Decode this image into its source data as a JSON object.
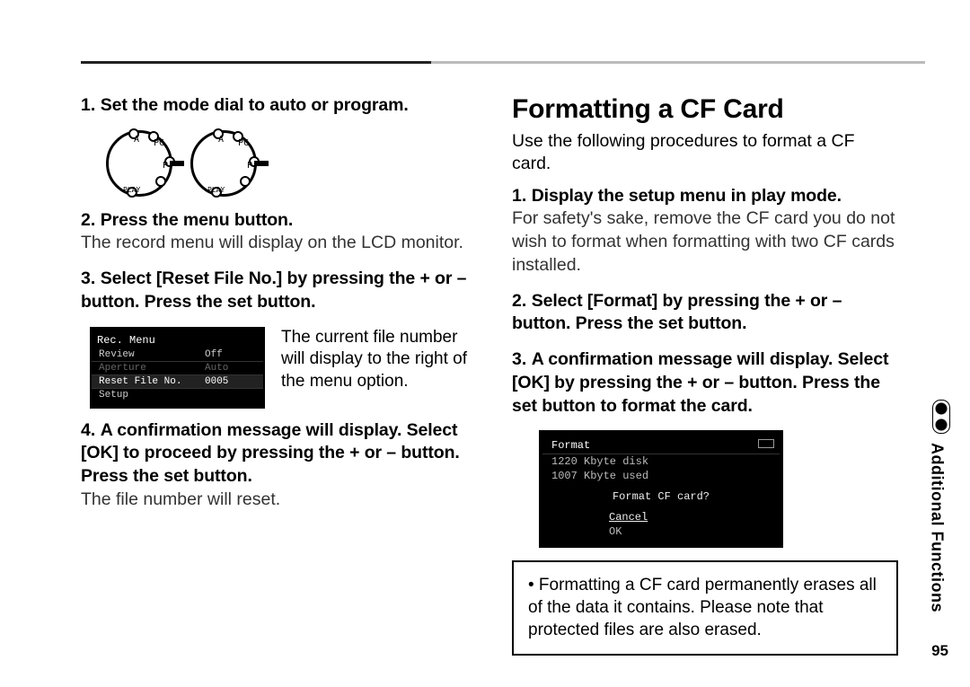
{
  "left": {
    "step1": {
      "num": "1.",
      "text": "Set the mode dial to auto or program."
    },
    "step2": {
      "num": "2.",
      "bold": "Press the menu button.",
      "desc": "The record menu will display on the LCD monitor."
    },
    "step3": {
      "num": "3.",
      "text": "Select [Reset File No.] by pressing the + or – button. Press the set button."
    },
    "lcd": {
      "title": "Rec. Menu",
      "rows": [
        {
          "label": "Review",
          "value": "Off"
        },
        {
          "label": "Aperture",
          "value": "Auto",
          "dim": true
        },
        {
          "label": "Reset File No.",
          "value": "0005",
          "hl": true
        },
        {
          "label": "Setup",
          "value": ""
        }
      ],
      "caption": "The current file number will display to the right of the menu option."
    },
    "step4": {
      "num": "4.",
      "bold": "A confirmation message will display. Select [OK] to proceed by pressing the + or – button. Press the set button.",
      "desc": "The file number will reset."
    }
  },
  "right": {
    "heading": "Formatting a CF Card",
    "intro": "Use the following procedures to format a CF card.",
    "step1": {
      "num": "1.",
      "bold": "Display the setup menu in play mode.",
      "desc": "For safety's sake, remove the CF card you do not wish to format when formatting with two CF cards installed."
    },
    "step2": {
      "num": "2.",
      "text": "Select [Format] by pressing the + or – button. Press the set button."
    },
    "step3": {
      "num": "3.",
      "text": "A confirmation message will display. Select [OK] by pressing the + or – button. Press the set button to format the card."
    },
    "lcd": {
      "title": "Format",
      "line1": "1220 Kbyte disk",
      "line2": "1007 Kbyte used",
      "prompt": "Format CF card?",
      "opt1": "Cancel",
      "opt2": "OK"
    },
    "note": "• Formatting a CF card permanently erases all of the data it contains. Please note that protected files are also erased."
  },
  "sidebar": "Additional Functions",
  "pagenum": "95",
  "dial": {
    "labels": {
      "top": "A",
      "tr": "PC",
      "r": "P",
      "bl": "PLAY"
    }
  }
}
